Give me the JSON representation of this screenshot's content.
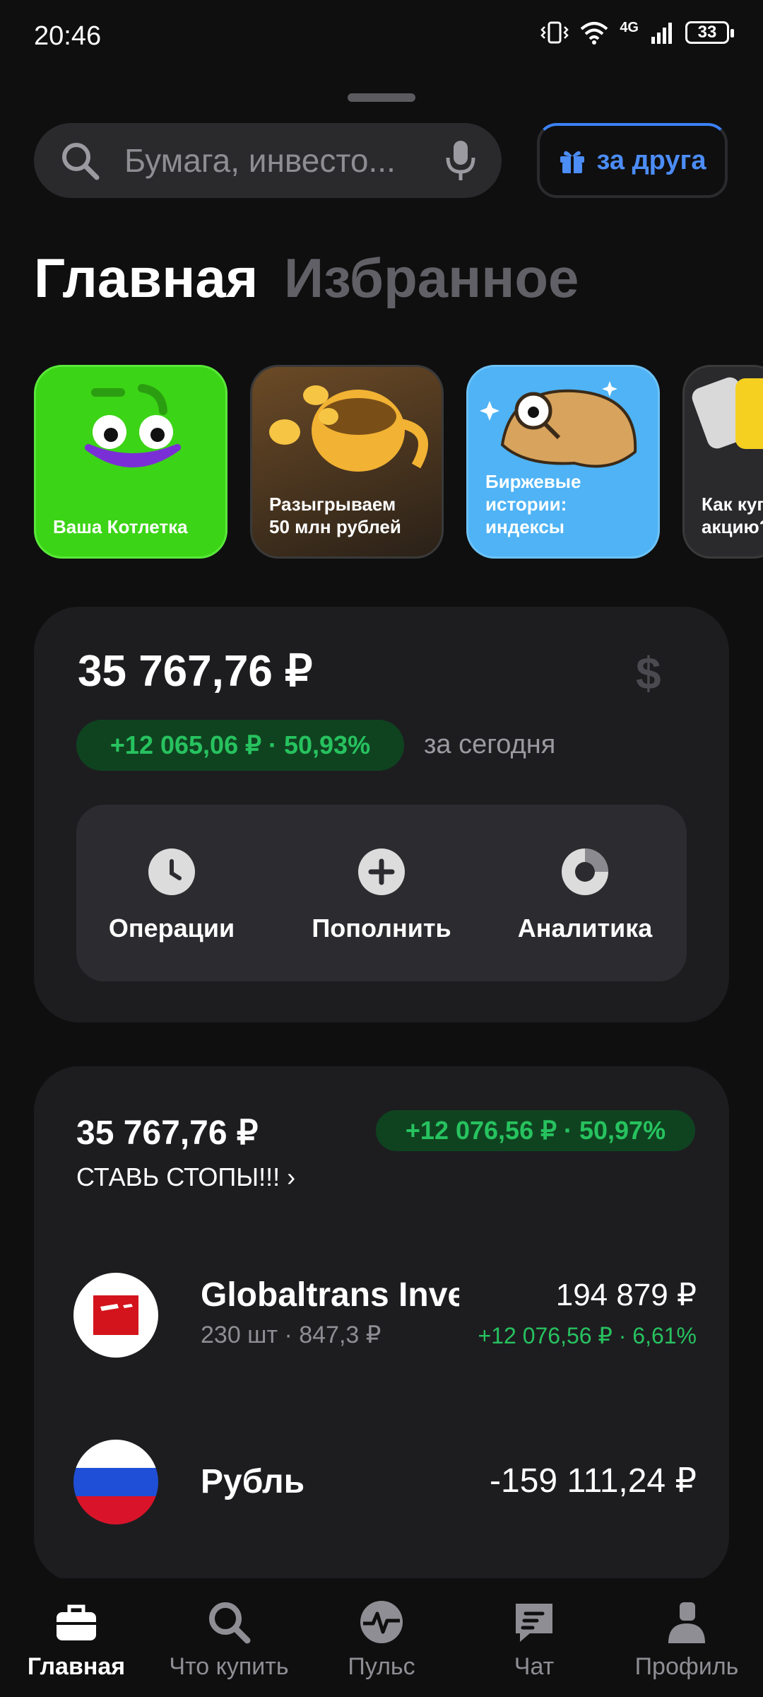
{
  "status": {
    "time": "20:46",
    "network": "4G",
    "battery": "33"
  },
  "search": {
    "placeholder": "Бумага, инвесто..."
  },
  "referral": {
    "label": "за друга"
  },
  "tabs": {
    "main": "Главная",
    "favorites": "Избранное"
  },
  "stories": [
    {
      "label": "Ваша Котлетка"
    },
    {
      "label": "Разыгрываем 50 млн рублей"
    },
    {
      "label": "Биржевые истории: индексы"
    },
    {
      "label": "Как купить акцию?"
    }
  ],
  "portfolio": {
    "total": "35 767,76 ₽",
    "today_change": "+12 065,06 ₽ · 50,93%",
    "today_label": "за сегодня",
    "actions": [
      {
        "label": "Операции",
        "icon": "clock-icon"
      },
      {
        "label": "Пополнить",
        "icon": "plus-icon"
      },
      {
        "label": "Аналитика",
        "icon": "donut-chart-icon"
      }
    ]
  },
  "account": {
    "total": "35 767,76 ₽",
    "change": "+12 076,56 ₽ · 50,97%",
    "name": "СТАВЬ СТОПЫ!!! ›",
    "assets": [
      {
        "name": "Globaltrans Investment",
        "sub": "230 шт · 847,3 ₽",
        "value": "194 879 ₽",
        "change": "+12 076,56 ₽ · 6,61%"
      },
      {
        "name": "Рубль",
        "value": "-159 111,24 ₽"
      }
    ]
  },
  "nav": [
    {
      "label": "Главная",
      "icon": "briefcase-icon"
    },
    {
      "label": "Что купить",
      "icon": "search-icon"
    },
    {
      "label": "Пульс",
      "icon": "pulse-icon"
    },
    {
      "label": "Чат",
      "icon": "chat-icon"
    },
    {
      "label": "Профиль",
      "icon": "profile-icon"
    }
  ],
  "colors": {
    "background": "#0f0f10",
    "accent_blue": "#4c8df6",
    "positive": "#27c25f",
    "card": "#1d1d20"
  }
}
